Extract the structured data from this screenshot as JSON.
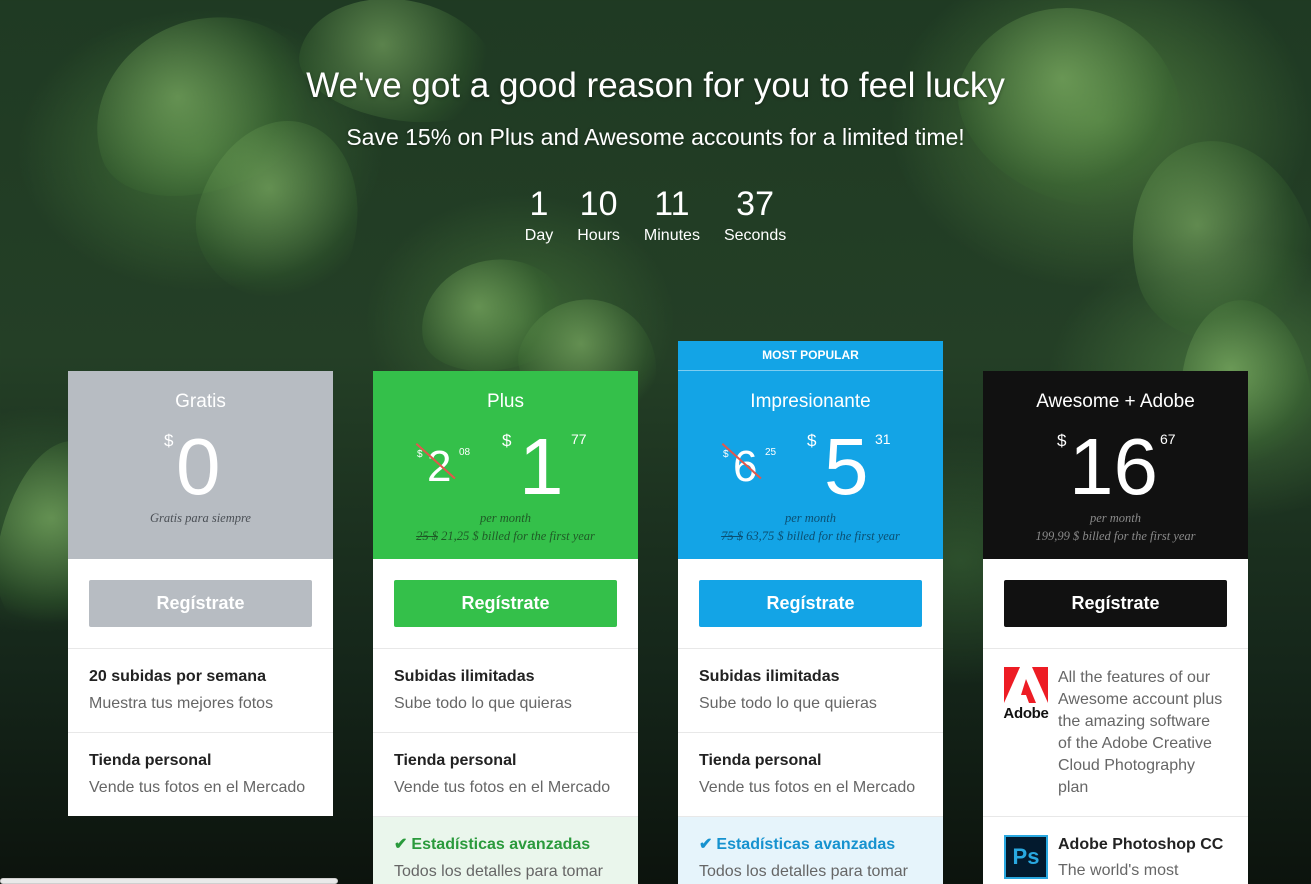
{
  "hero": {
    "title": "We've got a good reason for you to feel lucky",
    "subtitle": "Save 15% on Plus and Awesome accounts for a limited time!",
    "countdown": [
      {
        "value": "1",
        "label": "Day"
      },
      {
        "value": "10",
        "label": "Hours"
      },
      {
        "value": "11",
        "label": "Minutes"
      },
      {
        "value": "37",
        "label": "Seconds"
      }
    ]
  },
  "colors": {
    "gratis": "#b7bcc2",
    "plus": "#34c04a",
    "impresionante": "#13a4e6",
    "awesome": "#111111"
  },
  "plans": {
    "gratis": {
      "name": "Gratis",
      "currency": "$",
      "amount": "0",
      "tagline": "Gratis para siempre",
      "button": "Regístrate",
      "features": [
        {
          "title": "20 subidas por semana",
          "desc": "Muestra tus mejores fotos"
        },
        {
          "title": "Tienda personal",
          "desc": "Vende tus fotos en el Mercado"
        }
      ]
    },
    "plus": {
      "name": "Plus",
      "old_currency": "$",
      "old_amount": "2",
      "old_cents": "08",
      "currency": "$",
      "amount": "1",
      "cents": "77",
      "per": "per month",
      "billing_old": "25 $",
      "billing": "21,25 $ billed for the first year",
      "button": "Regístrate",
      "features": [
        {
          "title": "Subidas ilimitadas",
          "desc": "Sube todo lo que quieras"
        },
        {
          "title": "Tienda personal",
          "desc": "Vende tus fotos en el Mercado"
        },
        {
          "title": "Estadísticas avanzadas",
          "desc": "Todos los detalles para tomar"
        }
      ]
    },
    "impresionante": {
      "badge": "MOST POPULAR",
      "name": "Impresionante",
      "old_currency": "$",
      "old_amount": "6",
      "old_cents": "25",
      "currency": "$",
      "amount": "5",
      "cents": "31",
      "per": "per month",
      "billing_old": "75 $",
      "billing": "63,75 $ billed for the first year",
      "button": "Regístrate",
      "features": [
        {
          "title": "Subidas ilimitadas",
          "desc": "Sube todo lo que quieras"
        },
        {
          "title": "Tienda personal",
          "desc": "Vende tus fotos en el Mercado"
        },
        {
          "title": "Estadísticas avanzadas",
          "desc": "Todos los detalles para tomar"
        }
      ]
    },
    "awesome": {
      "name": "Awesome + Adobe",
      "currency": "$",
      "amount": "16",
      "cents": "67",
      "per": "per month",
      "billing": "199,99 $ billed for the first year",
      "button": "Regístrate",
      "adobe_word": "Adobe",
      "adobe_text": "All the features of our Awesome account plus the amazing software of the Adobe Creative Cloud Photography plan",
      "ps_label": "Ps",
      "ps_title": "Adobe Photoshop CC",
      "ps_desc": "The world's most"
    }
  },
  "icons": {
    "check": "✔"
  }
}
